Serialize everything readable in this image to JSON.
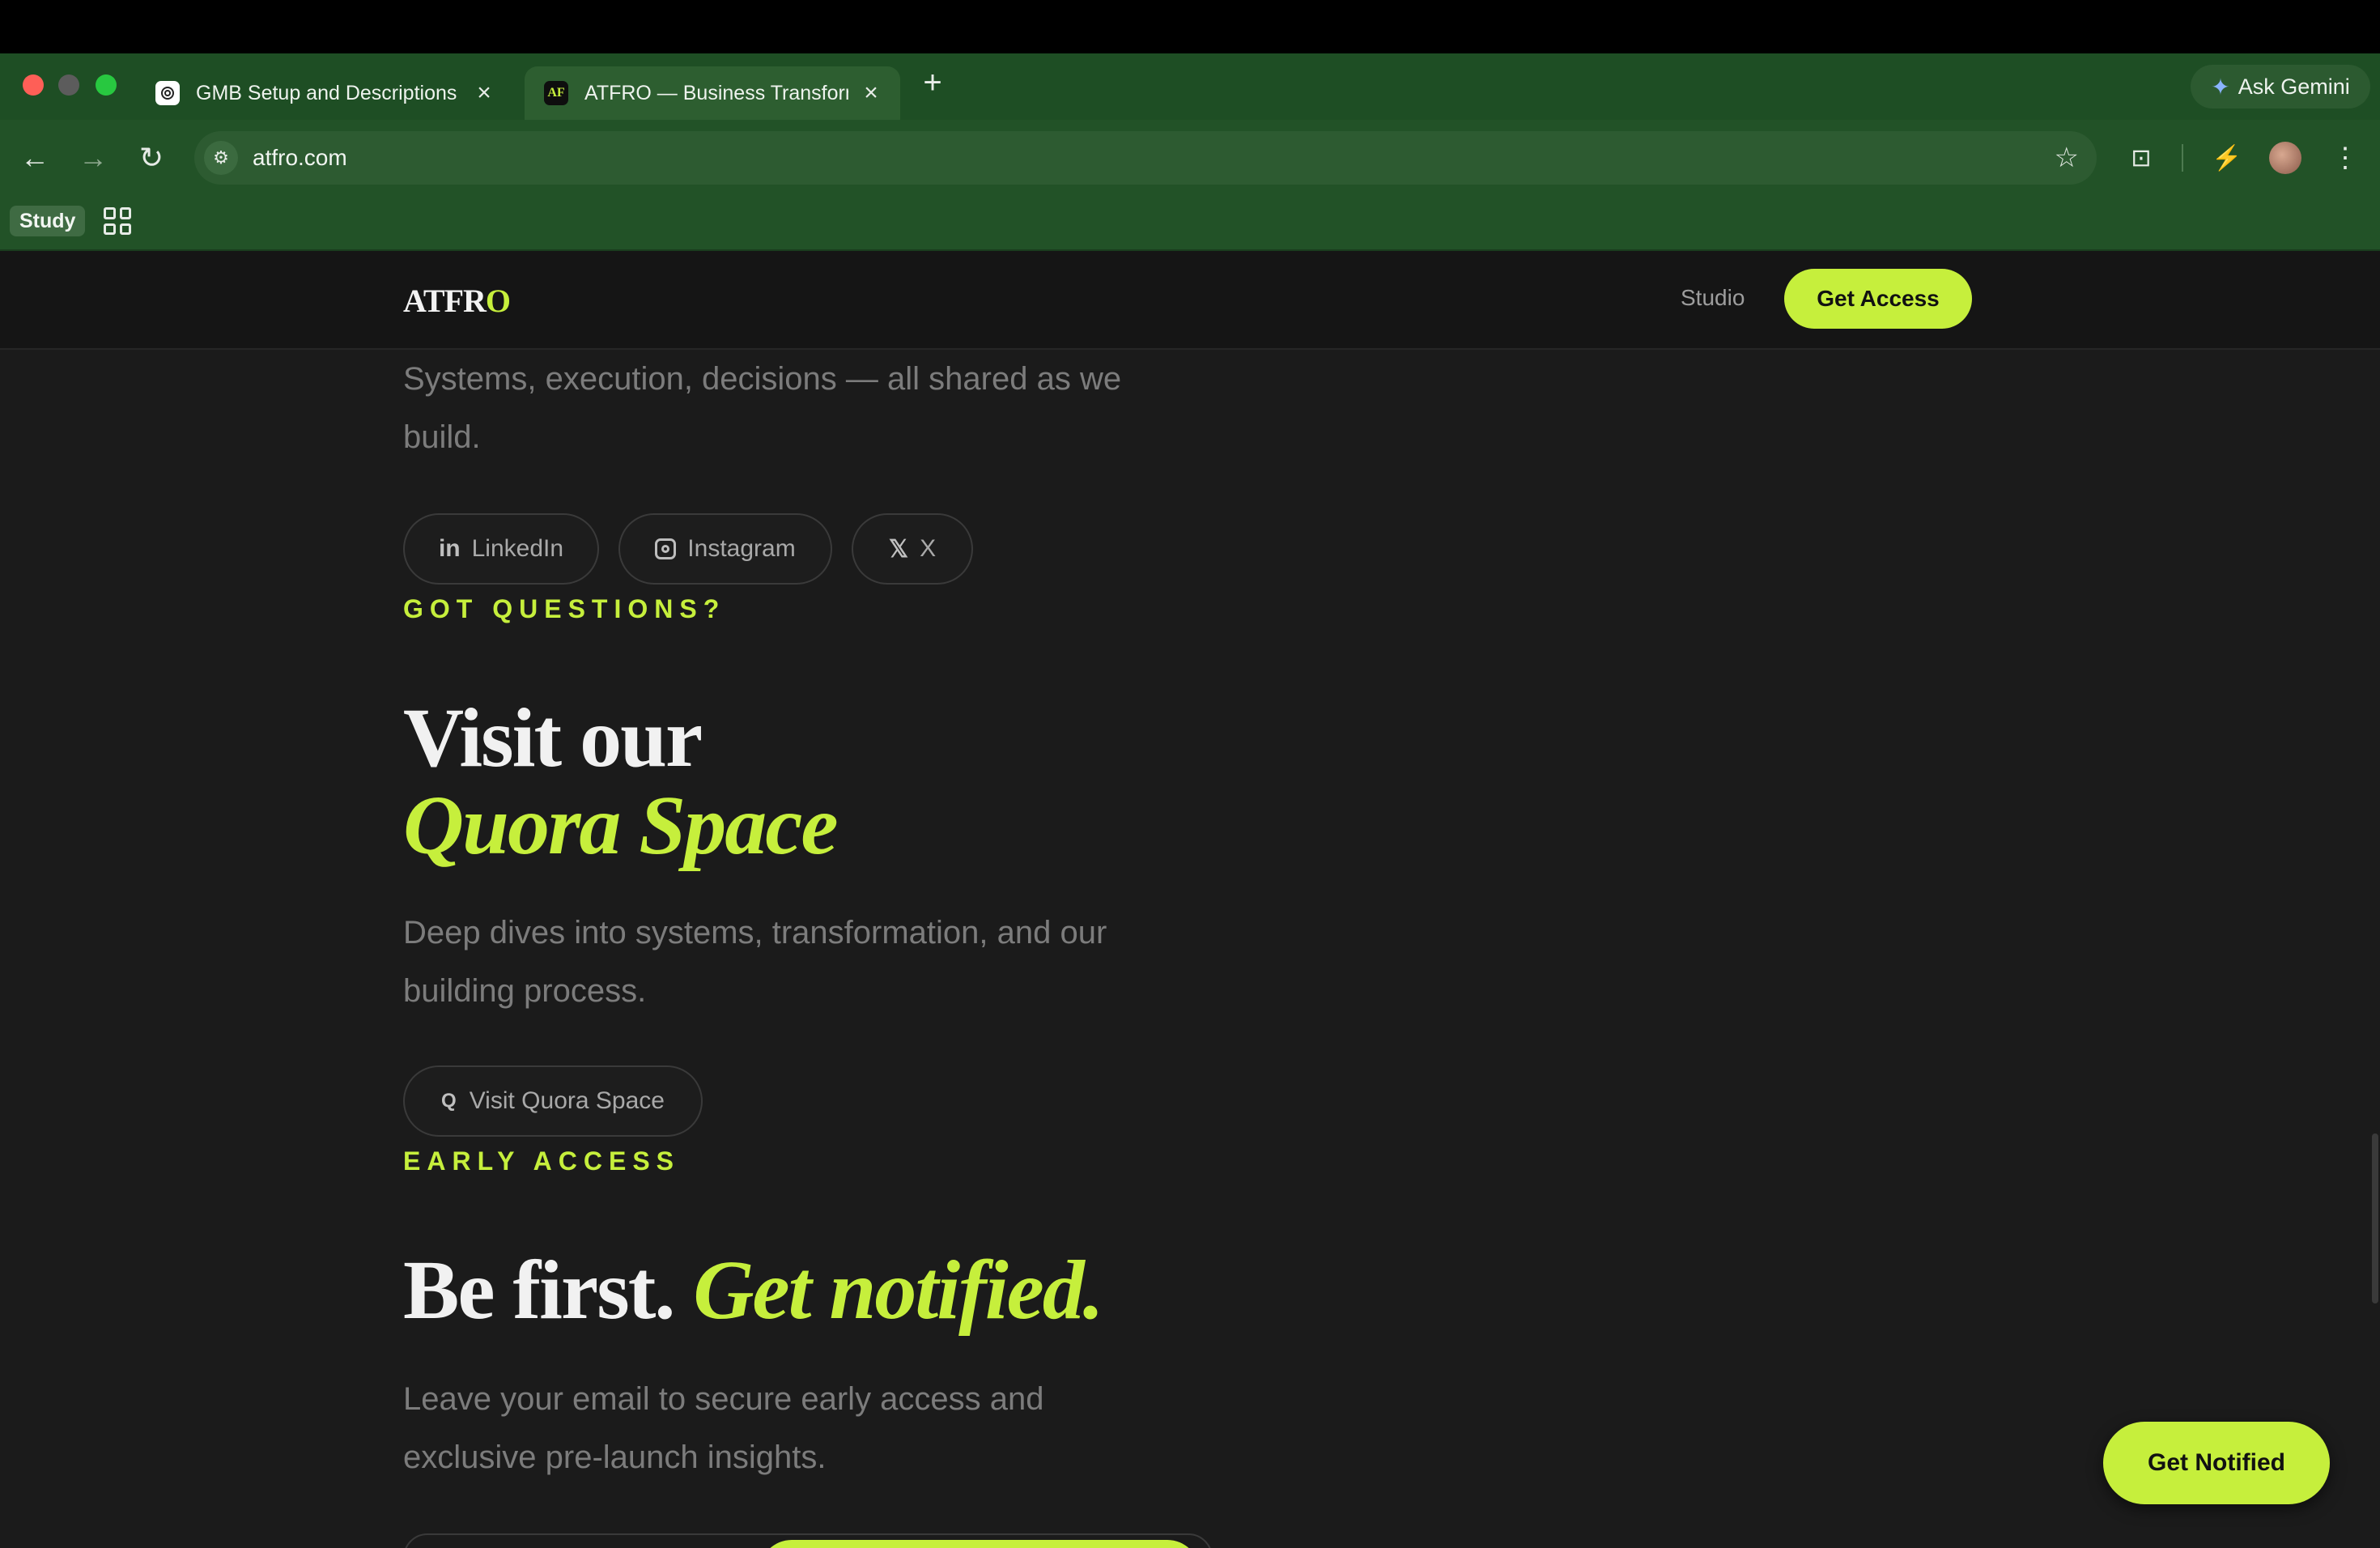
{
  "browser": {
    "tabs": [
      {
        "title": "GMB Setup and Descriptions",
        "favicon": "chatgpt-icon"
      },
      {
        "title": "ATFRO — Business Transform",
        "favicon_text": "AF"
      }
    ],
    "ask_gemini": "Ask Gemini",
    "url": "atfro.com",
    "bookmarks": {
      "study": "Study"
    }
  },
  "site": {
    "logo_main": "ATFR",
    "logo_accent": "O",
    "nav_studio": "Studio",
    "get_access": "Get Access",
    "intro_text": "Systems, execution, decisions — all shared as we build.",
    "social": {
      "linkedin": "LinkedIn",
      "instagram": "Instagram",
      "x": "X"
    },
    "questions": {
      "eyebrow": "GOT QUESTIONS?",
      "headline_1": "Visit our",
      "headline_2": "Quora Space",
      "body": "Deep dives into systems, transformation, and our building process.",
      "button": "Visit Quora Space",
      "button_icon": "Q"
    },
    "early_access": {
      "eyebrow": "EARLY ACCESS",
      "headline_1": "Be first.",
      "headline_2": "Get notified.",
      "body": "Leave your email to secure early access and exclusive pre-launch insights."
    },
    "floating_button": "Get Notified"
  },
  "colors": {
    "accent": "#c6ef3c",
    "page_bg": "#1b1b1b",
    "browser_chrome": "#225227"
  }
}
